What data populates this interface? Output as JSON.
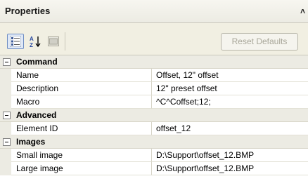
{
  "panel": {
    "title": "Properties",
    "chevron": "˄"
  },
  "toolbar": {
    "categorized_icon": "categorized-view-icon",
    "alphabetical_icon": "sort-az-icon",
    "property_pages_icon": "property-pages-icon",
    "reset_label": "Reset Defaults"
  },
  "grid": {
    "categories": [
      {
        "label": "Command",
        "properties": [
          {
            "name": "Name",
            "value": "Offset, 12\" offset"
          },
          {
            "name": "Description",
            "value": "12\" preset offset"
          },
          {
            "name": "Macro",
            "value": "^C^Coffset;12;"
          }
        ]
      },
      {
        "label": "Advanced",
        "properties": [
          {
            "name": "Element ID",
            "value": "offset_12"
          }
        ]
      },
      {
        "label": "Images",
        "properties": [
          {
            "name": "Small image",
            "value": "D:\\Support\\offset_12.BMP"
          },
          {
            "name": "Large image",
            "value": "D:\\Support\\offset_12.BMP"
          }
        ]
      }
    ]
  }
}
